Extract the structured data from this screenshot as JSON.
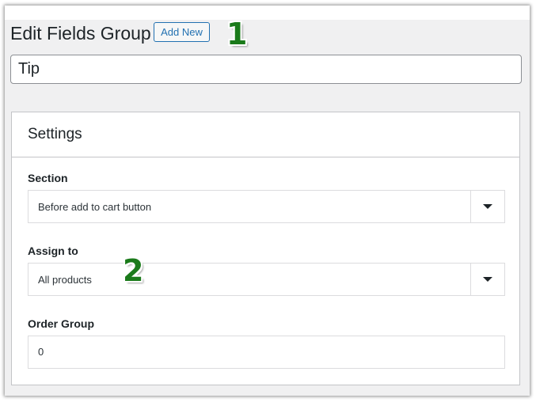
{
  "header": {
    "title": "Edit Fields Group",
    "add_new_label": "Add New"
  },
  "group_title": {
    "value": "Tip"
  },
  "settings": {
    "heading": "Settings",
    "section": {
      "label": "Section",
      "selected": "Before add to cart button"
    },
    "assign_to": {
      "label": "Assign to",
      "selected": "All products"
    },
    "order_group": {
      "label": "Order Group",
      "value": "0"
    }
  },
  "annotations": {
    "marker_1": "1",
    "marker_2": "2",
    "color": "#1a7a1a"
  },
  "colors": {
    "accent": "#2271b1",
    "background": "#f0f0f1"
  },
  "icons": {
    "dropdown": "caret-down-icon"
  }
}
